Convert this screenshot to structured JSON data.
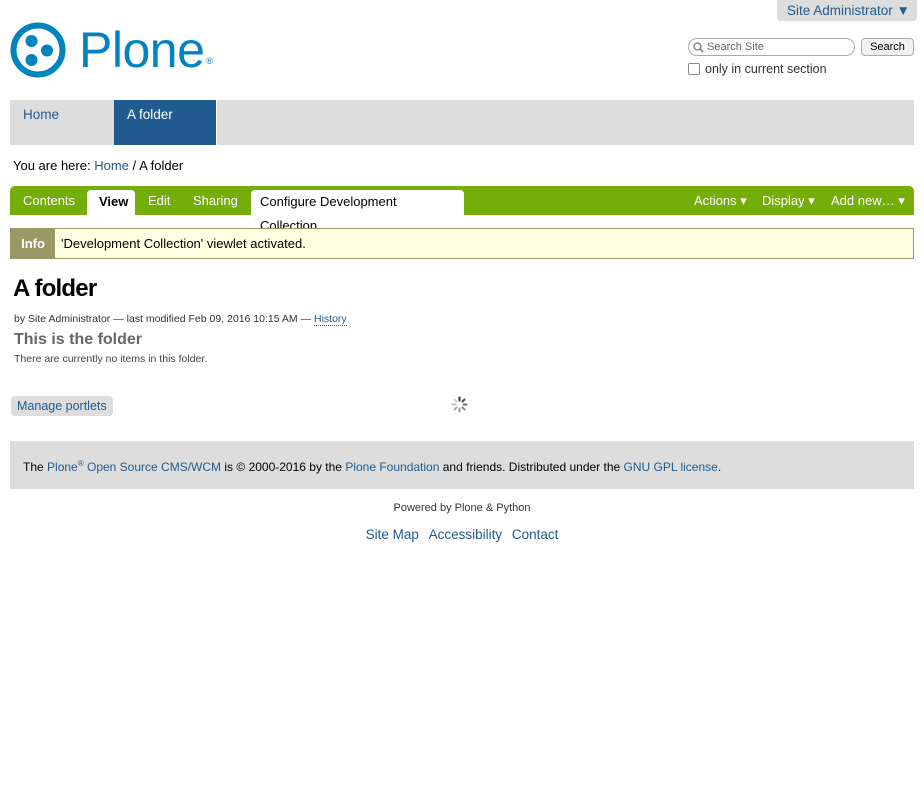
{
  "user_menu": {
    "label": "Site Administrator ▼"
  },
  "logo": {
    "text": "Plone",
    "reg": "®"
  },
  "search": {
    "placeholder": "Search Site",
    "button": "Search",
    "only_current": "only in current section"
  },
  "global_nav": {
    "tabs": [
      {
        "label": "Home"
      },
      {
        "label": "A folder"
      }
    ]
  },
  "breadcrumb": {
    "prefix": "You are here:",
    "home": "Home",
    "sep": "/",
    "current": "A folder"
  },
  "edit_bar": {
    "tabs": [
      {
        "label": "Contents"
      },
      {
        "label": "View"
      },
      {
        "label": "Edit"
      },
      {
        "label": "Sharing"
      },
      {
        "label": "Configure Development Collection"
      }
    ],
    "menus": [
      {
        "label": "Actions ▾"
      },
      {
        "label": "Display ▾"
      },
      {
        "label": "Add new… ▾"
      }
    ]
  },
  "info": {
    "label": "Info",
    "message": "'Development Collection' viewlet activated."
  },
  "content": {
    "title": "A folder",
    "byline": "by Site Administrator — last modified Feb 09, 2016 10:15 AM —",
    "history": "History",
    "description": "This is the folder",
    "empty": "There are currently no items in this folder."
  },
  "manage_portlets": "Manage portlets",
  "footer": {
    "the": "The",
    "plone": "Plone",
    "reg": "®",
    "cms": "Open Source CMS/WCM",
    "is": "is",
    "copyright": "© 2000-2016 by the",
    "foundation": "Plone Foundation",
    "friends": "and friends. Distributed under the",
    "license": "GNU GPL license",
    "end": "."
  },
  "colophon": "Powered by Plone & Python",
  "site_actions": [
    {
      "label": "Site Map"
    },
    {
      "label": "Accessibility"
    },
    {
      "label": "Contact"
    }
  ],
  "colors": {
    "plone_blue": "#0083be",
    "nav_blue": "#205c90",
    "edit_green": "#75ad0a",
    "info_olive": "#999966",
    "gray": "#dddddd"
  }
}
